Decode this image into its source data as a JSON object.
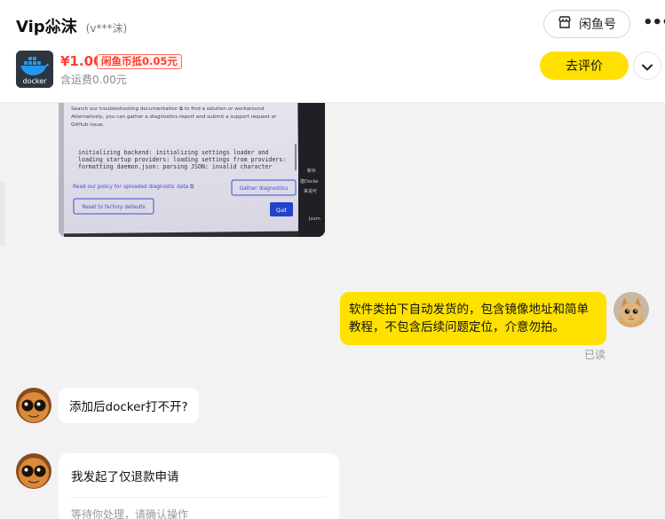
{
  "header": {
    "seller_name": "Vip尛沫",
    "seller_id": "(v***沫)",
    "xianyu_button": "闲鱼号",
    "more_icon": "more-dots-icon"
  },
  "product": {
    "thumb_label": "docker",
    "price": "¥1.00",
    "coin_badge": "闲鱼币抵0.05元",
    "shipping": "含运费0.00元",
    "review_button": "去评价"
  },
  "shared_image": {
    "line1": "Search our troubleshooting documentation ⧉ to find a solution or workaround.",
    "line2": "Alternatively, you can gather a diagnostics report and submit a support request or",
    "line3": "GitHub issue.",
    "err1": "initializing backend: initializing settings loader and",
    "err2": "loading startup providers: loading settings from providers:",
    "err3": "formatting daemon.json: parsing JSON: invalid character",
    "policy_link": "Read our policy for uploaded diagnostic data ⧉",
    "gather_button": "Gather diagnostics",
    "reset_button": "Reset to factory defaults",
    "quit_button": "Quit",
    "side1": "新补",
    "side2": "建Docke",
    "side3": "来说可",
    "side4": "Journ"
  },
  "messages": [
    {
      "side": "right",
      "text": "软件类拍下自动发货的，包含镜像地址和简单教程，不包含后续问题定位，介意勿拍。",
      "status": "已读"
    },
    {
      "side": "left",
      "text": "添加后docker打不开?"
    },
    {
      "side": "left",
      "type": "card",
      "title": "我发起了仅退款申请",
      "subtitle": "等待你处理，请确认操作"
    }
  ],
  "colors": {
    "accent_yellow": "#ffe100",
    "price_red": "#ff3d2e"
  }
}
